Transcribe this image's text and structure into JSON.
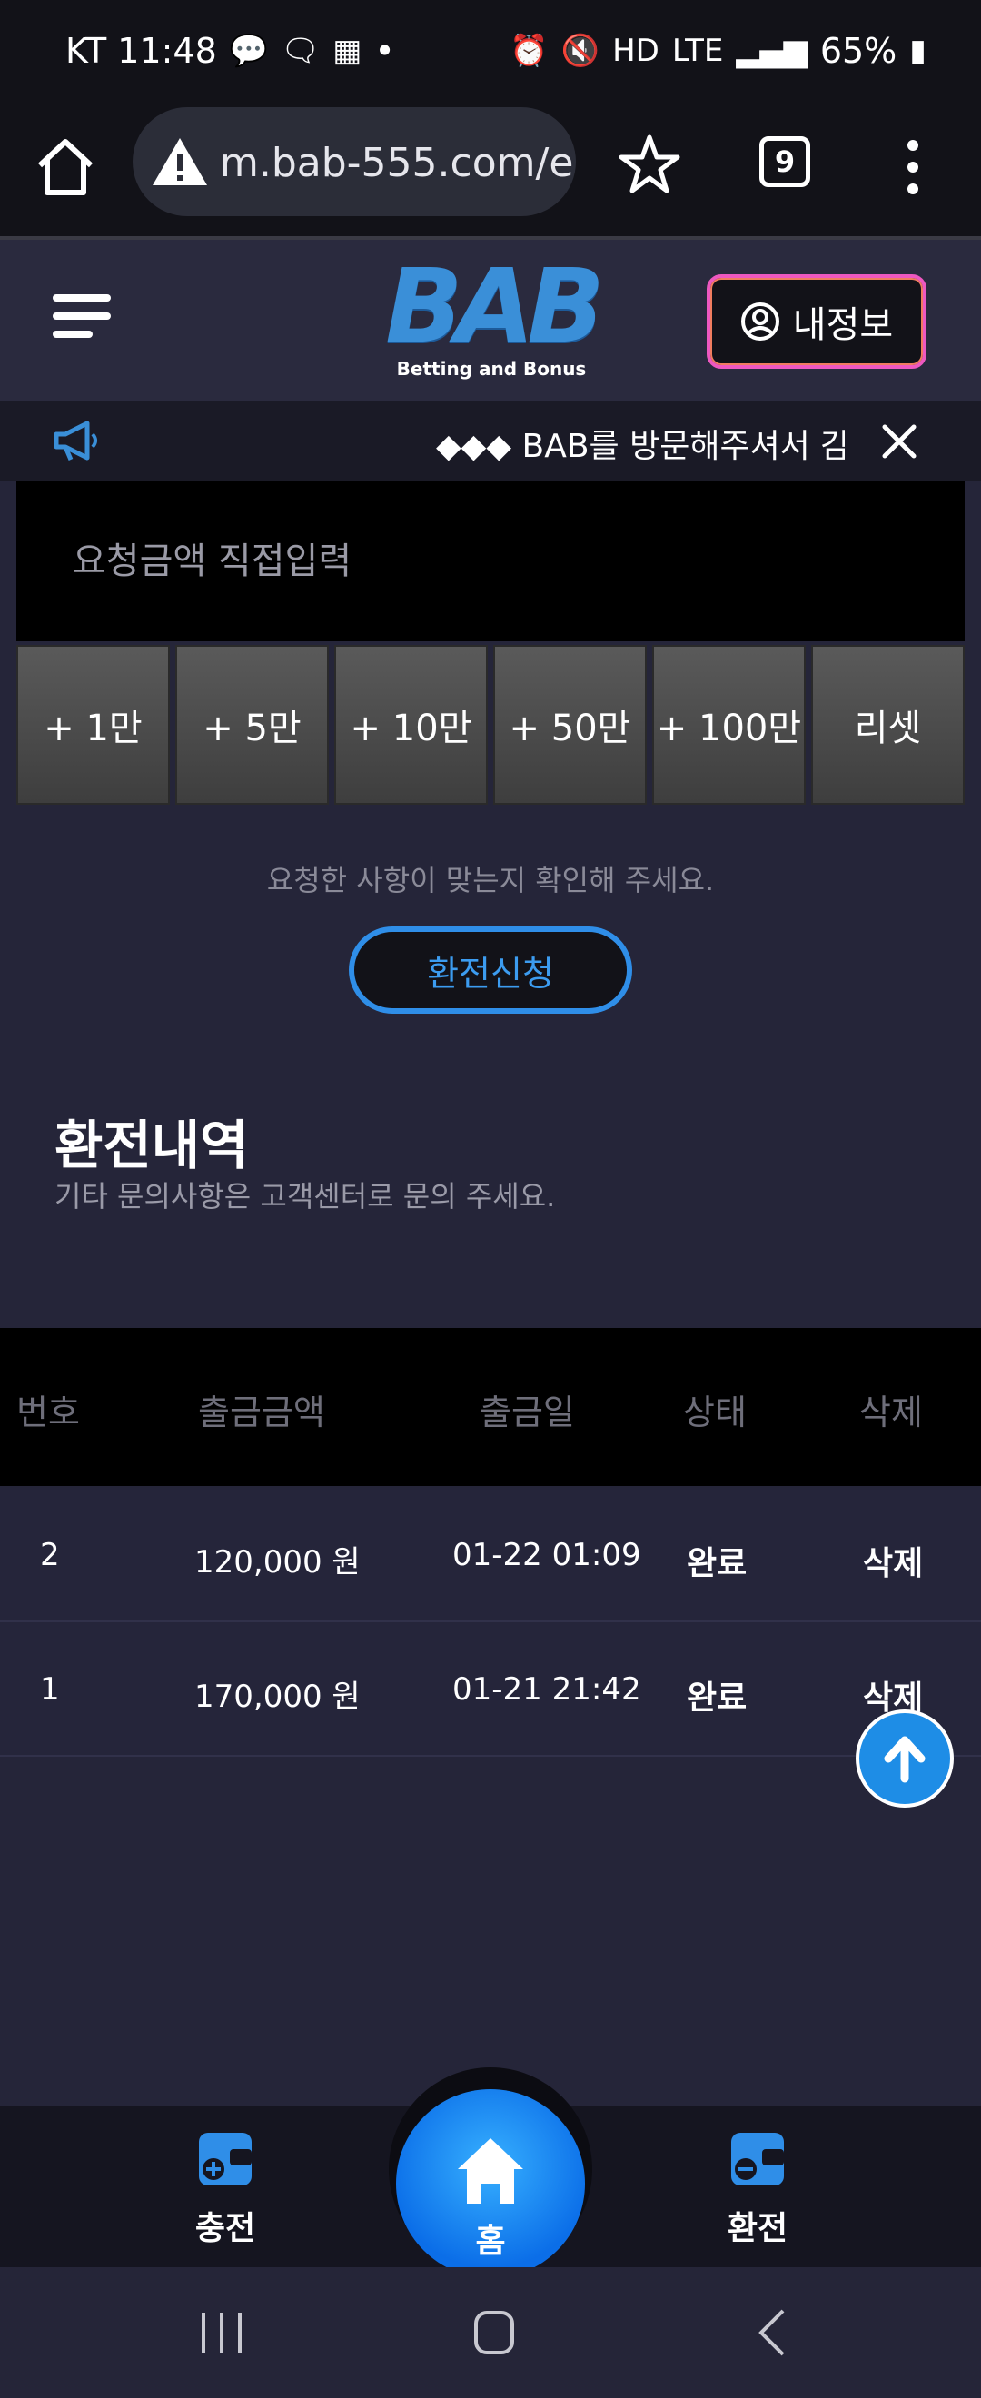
{
  "status_bar": {
    "carrier_time": "KT 11:48",
    "dot": "•",
    "battery": "65%"
  },
  "browser": {
    "url": "m.bab-555.com/e",
    "tab_count": "9"
  },
  "header": {
    "logo_main": "BAB",
    "logo_sub": "Betting and Bonus",
    "myinfo_label": "내정보"
  },
  "notice": {
    "text": "◆◆◆ BAB를 방문해주셔서 감사"
  },
  "amount": {
    "placeholder": "요청금액 직접입력",
    "buttons": [
      "+ 1만",
      "+ 5만",
      "+ 10만",
      "+ 50만",
      "+ 100만",
      "리셋"
    ]
  },
  "confirm_text": "요청한 사항이 맞는지 확인해 주세요.",
  "exchange_button": "환전신청",
  "history": {
    "title": "환전내역",
    "subtitle": "기타 문의사항은 고객센터로 문의 주세요.",
    "columns": [
      "번호",
      "출금금액",
      "출금일",
      "상태",
      "삭제"
    ],
    "rows": [
      {
        "no": "2",
        "amount": "120,000 원",
        "date": "01-22 01:09",
        "status": "완료",
        "delete": "삭제"
      },
      {
        "no": "1",
        "amount": "170,000 원",
        "date": "01-21 21:42",
        "status": "완료",
        "delete": "삭제"
      }
    ]
  },
  "bottom_nav": {
    "charge": "충전",
    "home": "홈",
    "exchange": "환전"
  },
  "colors": {
    "accent_blue": "#2f8ee8",
    "myinfo_border": "#ee58c0",
    "background": "#252539"
  }
}
